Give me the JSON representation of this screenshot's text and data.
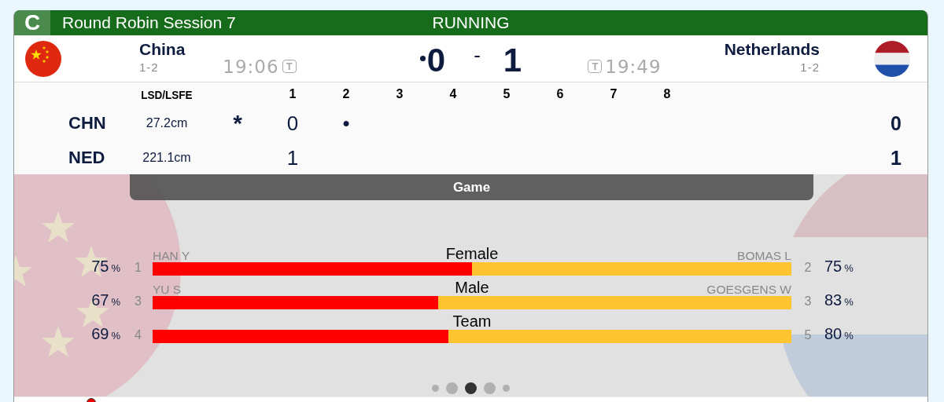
{
  "header": {
    "badge": "C",
    "title": "Round Robin Session 7",
    "status": "RUNNING"
  },
  "teams": [
    {
      "name": "China",
      "record": "1-2",
      "time": "19:06",
      "timeout_badge": "T",
      "score": "0",
      "hammer": true,
      "kind": "china"
    },
    {
      "name": "Netherlands",
      "record": "1-2",
      "time": "19:49",
      "timeout_badge": "T",
      "score": "1",
      "hammer": false,
      "kind": "netherlands"
    }
  ],
  "score_separator": "-",
  "linescore": {
    "columns": [
      "LSD/LSFE",
      "1",
      "2",
      "3",
      "4",
      "5",
      "6",
      "7",
      "8"
    ],
    "rows": [
      {
        "team": "CHN",
        "lsd": "27.2cm",
        "marker": "*",
        "ends": [
          "0",
          "•"
        ],
        "total": "0"
      },
      {
        "team": "NED",
        "lsd": "221.1cm",
        "ends": [
          "1"
        ],
        "total": "1"
      }
    ]
  },
  "section_title": "Game",
  "stats": [
    {
      "category": "Female",
      "level": 0.5,
      "left": {
        "value": "75",
        "unit": "%",
        "seed": "1",
        "name": "HAN Y"
      },
      "right": {
        "value": "75",
        "unit": "%",
        "seed": "2",
        "name": "BOMAS L"
      }
    },
    {
      "category": "Male",
      "level": 0.447,
      "left": {
        "value": "67",
        "unit": "%",
        "seed": "3",
        "name": "YU S"
      },
      "right": {
        "value": "83",
        "unit": "%",
        "seed": "3",
        "name": "GOESGENS W"
      }
    },
    {
      "category": "Team",
      "level": 0.463,
      "left": {
        "value": "69",
        "unit": "%",
        "seed": "4"
      },
      "right": {
        "value": "80",
        "unit": "%",
        "seed": "5"
      }
    }
  ],
  "pager": [
    {
      "selected": false
    },
    {
      "selected": false
    },
    {
      "selected": true
    },
    {
      "selected": false
    },
    {
      "selected": false
    }
  ]
}
